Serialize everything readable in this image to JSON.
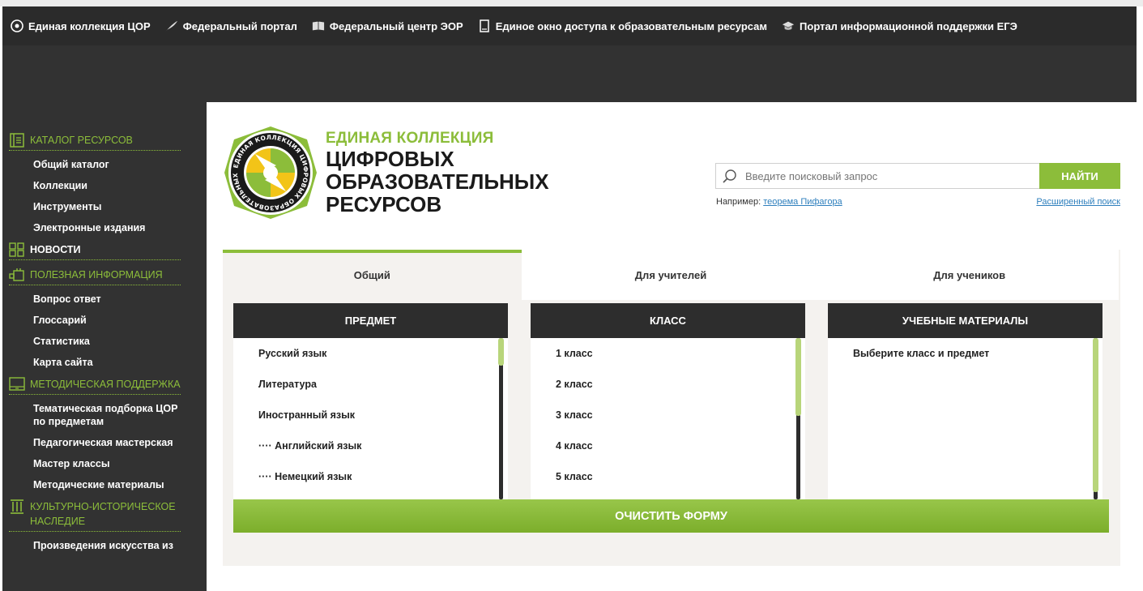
{
  "top_nav": [
    {
      "label": "Единая коллекция ЦОР",
      "icon": "disc-icon"
    },
    {
      "label": "Федеральный портал",
      "icon": "feather-icon"
    },
    {
      "label": "Федеральный центр ЭОР",
      "icon": "book-icon"
    },
    {
      "label": "Единое окно доступа к образовательным ресурсам",
      "icon": "document-icon"
    },
    {
      "label": "Портал информационной поддержки ЕГЭ",
      "icon": "graduation-cap-icon"
    }
  ],
  "sidebar": {
    "sections": [
      {
        "title": "Каталог ресурсов",
        "icon": "catalog-icon",
        "items": [
          "Общий каталог",
          "Коллекции",
          "Инструменты",
          "Электронные издания"
        ]
      },
      {
        "title": "Новости",
        "icon": "grid-icon",
        "items": []
      },
      {
        "title": "Полезная информация",
        "icon": "info-blocks-icon",
        "items": [
          "Вопрос ответ",
          "Глоссарий",
          "Статистика",
          "Карта сайта"
        ]
      },
      {
        "title": "Методическая поддержка",
        "icon": "monitor-icon",
        "items": [
          "Тематическая подборка ЦОР по предметам",
          "Педагогическая мастерская",
          "Мастер классы",
          "Методические материалы"
        ]
      },
      {
        "title": "Культурно-историческое наследие",
        "icon": "columns-icon",
        "items": [
          "Произведения искусства из"
        ]
      }
    ]
  },
  "brand": {
    "line1": "ЕДИНАЯ КОЛЛЕКЦИЯ",
    "line2": "ЦИФРОВЫХ",
    "line3": "ОБРАЗОВАТЕЛЬНЫХ",
    "line4": "РЕСУРСОВ",
    "logo_ring_text": "ЕДИНАЯ КОЛЛЕКЦИЯ ЦИФРОВЫХ ОБРАЗОВАТЕЛЬНЫХ РЕСУРСОВ"
  },
  "search": {
    "placeholder": "Введите поисковый запрос",
    "button": "НАЙТИ",
    "example_prefix": "Например:",
    "example_link": "теорема Пифагора",
    "advanced": "Расширенный поиск"
  },
  "tabs": [
    {
      "label": "Общий",
      "active": true
    },
    {
      "label": "Для учителей",
      "active": false
    },
    {
      "label": "Для учеников",
      "active": false
    }
  ],
  "columns": {
    "subject": {
      "header": "ПРЕДМЕТ",
      "items": [
        "Русский язык",
        "Литература",
        "Иностранный язык",
        "···· Английский язык",
        "···· Немецкий язык"
      ]
    },
    "grade": {
      "header": "КЛАСС",
      "items": [
        "1 класс",
        "2 класс",
        "3 класс",
        "4 класс",
        "5 класс"
      ]
    },
    "materials": {
      "header": "УЧЕБНЫЕ МАТЕРИАЛЫ",
      "items": [
        "Выберите класс и предмет"
      ]
    }
  },
  "clear_button": "ОЧИСТИТЬ ФОРМУ",
  "colors": {
    "accent": "#8cbd3a",
    "dark": "#323232",
    "topbar": "#2b2b2b",
    "panel": "#f4f2ef"
  }
}
